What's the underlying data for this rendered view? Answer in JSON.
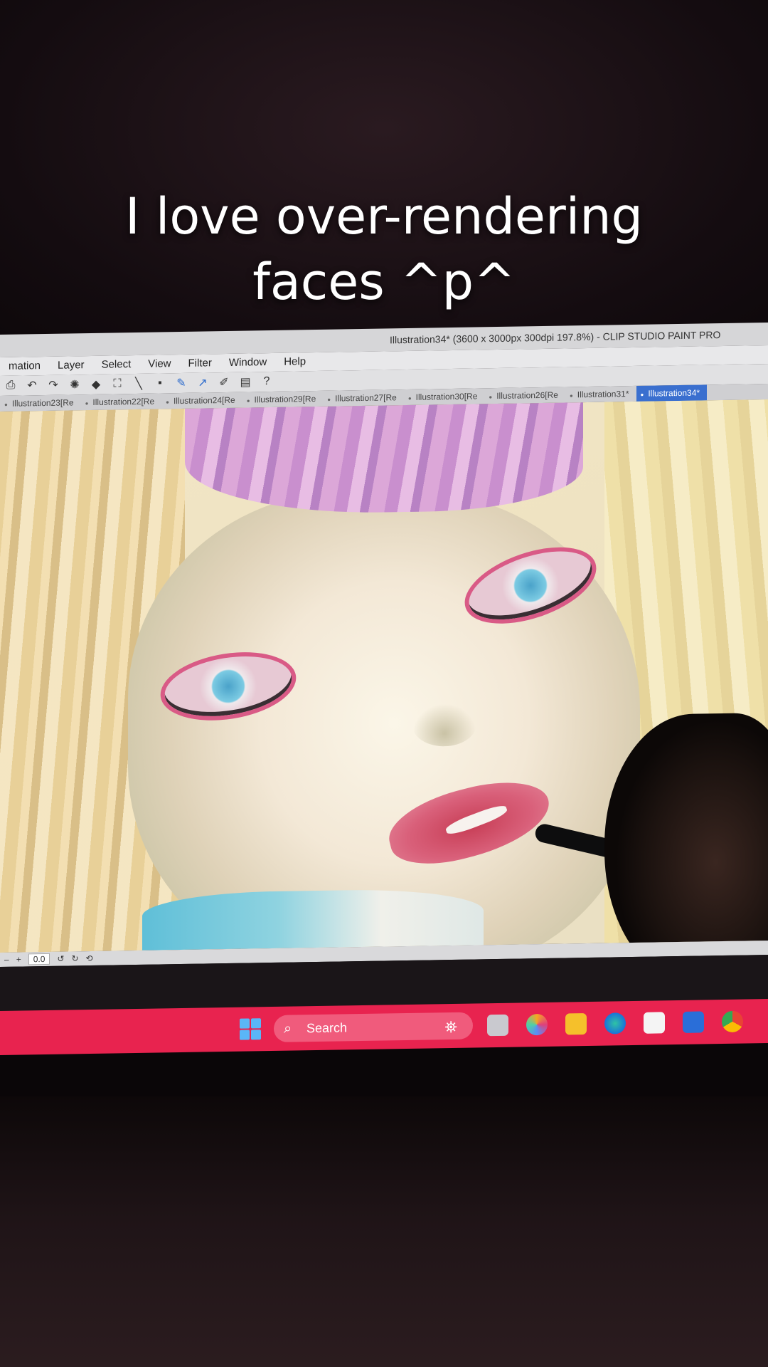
{
  "caption": {
    "line1": "I love over-rendering",
    "line2": "faces ^p^"
  },
  "app": {
    "window_title": "Illustration34* (3600 x 3000px 300dpi 197.8%)  - CLIP STUDIO PAINT PRO",
    "menu": [
      "mation",
      "Layer",
      "Select",
      "View",
      "Filter",
      "Window",
      "Help"
    ],
    "toolbar_icons": [
      "print-icon",
      "undo-icon",
      "redo-icon",
      "loading-icon",
      "fill-icon",
      "transform-icon",
      "ruler-icon",
      "snap-icon",
      "pen-blue-icon",
      "pen-curve-icon",
      "pen-icon",
      "document-icon",
      "help-icon"
    ],
    "tabs": [
      {
        "label": "Illustration23[Re",
        "active": false
      },
      {
        "label": "Illustration22[Re",
        "active": false
      },
      {
        "label": "Illustration24[Re",
        "active": false
      },
      {
        "label": "Illustration29[Re",
        "active": false
      },
      {
        "label": "Illustration27[Re",
        "active": false
      },
      {
        "label": "Illustration30[Re",
        "active": false
      },
      {
        "label": "Illustration26[Re",
        "active": false
      },
      {
        "label": "Illustration31*",
        "active": false
      },
      {
        "label": "Illustration34*",
        "active": true
      }
    ],
    "status": {
      "minus": "–",
      "plus": "+",
      "zoom_value": "0.0"
    }
  },
  "taskbar": {
    "search_label": "Search",
    "icons": [
      "windows-start-icon",
      "task-view-icon",
      "copilot-icon",
      "file-explorer-icon",
      "edge-icon",
      "store-icon",
      "mail-icon",
      "chrome-icon"
    ],
    "color": "#e8234f"
  }
}
